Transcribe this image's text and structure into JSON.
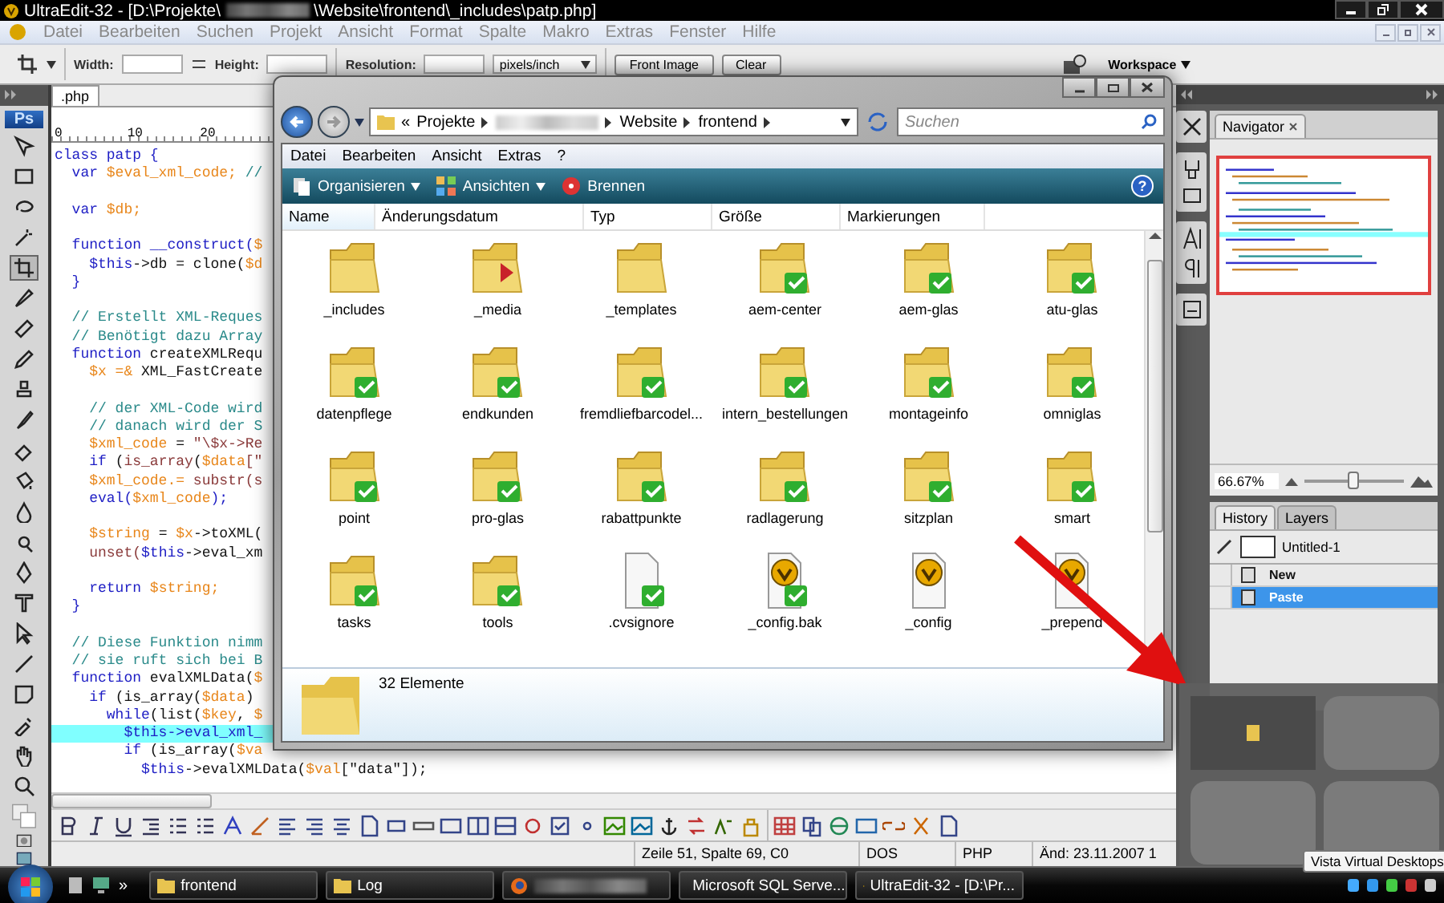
{
  "window": {
    "title_start": "UltraEdit-32 - [D:\\Projekte\\",
    "title_end": "\\Website\\frontend\\_includes\\patp.php]"
  },
  "menu": [
    "Datei",
    "Bearbeiten",
    "Suchen",
    "Projekt",
    "Ansicht",
    "Format",
    "Spalte",
    "Makro",
    "Extras",
    "Fenster",
    "Hilfe"
  ],
  "options_bar": {
    "width_label": "Width:",
    "height_label": "Height:",
    "resolution_label": "Resolution:",
    "unit": "pixels/inch",
    "buttons": [
      "Front Image",
      "Clear"
    ],
    "workspace": "Workspace"
  },
  "toolbox": {
    "logo": "Ps"
  },
  "editor": {
    "tab": ".php",
    "ruler": [
      "0",
      "10",
      "20"
    ],
    "lines": [
      {
        "current": false,
        "segs": [
          {
            "kind": "kw",
            "text": "class patp {"
          }
        ]
      },
      {
        "current": false,
        "segs": [
          {
            "kind": "kw",
            "text": "  var "
          },
          {
            "kind": "var",
            "text": "$eval_xml_code;"
          },
          {
            "kind": "com",
            "text": " //"
          }
        ]
      },
      {
        "current": false
      },
      {
        "current": false,
        "segs": [
          {
            "kind": "kw",
            "text": "  var "
          },
          {
            "kind": "var",
            "text": "$db;"
          }
        ]
      },
      {
        "current": false
      },
      {
        "current": false,
        "segs": [
          {
            "kind": "kw",
            "text": "  function __construct("
          },
          {
            "kind": "var",
            "text": "$"
          }
        ]
      },
      {
        "current": false,
        "segs": [
          {
            "kind": "kw",
            "text": "    $this"
          },
          {
            "kind": "txt",
            "text": "->db = clone("
          },
          {
            "kind": "var",
            "text": "$d"
          }
        ]
      },
      {
        "current": false,
        "segs": [
          {
            "kind": "kw",
            "text": "  }"
          }
        ]
      },
      {
        "current": false
      },
      {
        "current": false,
        "segs": [
          {
            "kind": "com",
            "text": "  // Erstellt XML-Reques"
          }
        ]
      },
      {
        "current": false,
        "segs": [
          {
            "kind": "com",
            "text": "  // Benötigt dazu Array"
          }
        ]
      },
      {
        "current": false,
        "segs": [
          {
            "kind": "kw",
            "text": "  function "
          },
          {
            "kind": "txt",
            "text": "createXMLRequ"
          }
        ]
      },
      {
        "current": false,
        "segs": [
          {
            "kind": "var",
            "text": "    $x =& "
          },
          {
            "kind": "txt",
            "text": "XML_FastCreate"
          }
        ]
      },
      {
        "current": false
      },
      {
        "current": false,
        "segs": [
          {
            "kind": "com",
            "text": "    // der XML-Code wird"
          }
        ]
      },
      {
        "current": false,
        "segs": [
          {
            "kind": "com",
            "text": "    // danach wird der S"
          }
        ]
      },
      {
        "current": false,
        "segs": [
          {
            "kind": "var",
            "text": "    $xml_code"
          },
          {
            "kind": "txt",
            "text": " = "
          },
          {
            "kind": "fn",
            "text": "\"\\$x->Re"
          }
        ]
      },
      {
        "current": false,
        "segs": [
          {
            "kind": "kw",
            "text": "    if "
          },
          {
            "kind": "txt",
            "text": "("
          },
          {
            "kind": "fn",
            "text": "is_array"
          },
          {
            "kind": "txt",
            "text": "("
          },
          {
            "kind": "var",
            "text": "$data"
          },
          {
            "kind": "fn",
            "text": "[\""
          }
        ]
      },
      {
        "current": false,
        "segs": [
          {
            "kind": "var",
            "text": "    $xml_code.= "
          },
          {
            "kind": "fn",
            "text": "substr(s"
          }
        ]
      },
      {
        "current": false,
        "segs": [
          {
            "kind": "kw",
            "text": "    eval("
          },
          {
            "kind": "var",
            "text": "$xml_code"
          },
          {
            "kind": "kw",
            "text": ");"
          }
        ]
      },
      {
        "current": false
      },
      {
        "current": false,
        "segs": [
          {
            "kind": "var",
            "text": "    $string"
          },
          {
            "kind": "txt",
            "text": " = "
          },
          {
            "kind": "var",
            "text": "$x"
          },
          {
            "kind": "txt",
            "text": "->toXML("
          }
        ]
      },
      {
        "current": false,
        "segs": [
          {
            "kind": "fn",
            "text": "    unset("
          },
          {
            "kind": "kw",
            "text": "$this"
          },
          {
            "kind": "txt",
            "text": "->eval_xm"
          }
        ]
      },
      {
        "current": false
      },
      {
        "current": false,
        "segs": [
          {
            "kind": "kw",
            "text": "    return "
          },
          {
            "kind": "var",
            "text": "$string;"
          }
        ]
      },
      {
        "current": false,
        "segs": [
          {
            "kind": "kw",
            "text": "  }"
          }
        ]
      },
      {
        "current": false
      },
      {
        "current": false,
        "segs": [
          {
            "kind": "com",
            "text": "  // Diese Funktion nimm"
          }
        ]
      },
      {
        "current": false,
        "segs": [
          {
            "kind": "com",
            "text": "  // sie ruft sich bei B"
          }
        ]
      },
      {
        "current": false,
        "segs": [
          {
            "kind": "kw",
            "text": "  function "
          },
          {
            "kind": "txt",
            "text": "evalXMLData("
          },
          {
            "kind": "var",
            "text": "$"
          }
        ]
      },
      {
        "current": false,
        "segs": [
          {
            "kind": "kw",
            "text": "    if "
          },
          {
            "kind": "txt",
            "text": "(is_array("
          },
          {
            "kind": "var",
            "text": "$data"
          },
          {
            "kind": "txt",
            "text": ")"
          }
        ]
      },
      {
        "current": false,
        "segs": [
          {
            "kind": "kw",
            "text": "      while"
          },
          {
            "kind": "txt",
            "text": "(list("
          },
          {
            "kind": "var",
            "text": "$key"
          },
          {
            "kind": "txt",
            "text": ", "
          },
          {
            "kind": "var",
            "text": "$"
          }
        ]
      },
      {
        "current": true,
        "segs": [
          {
            "kind": "kw",
            "text": "        $this->eval_xml_"
          }
        ]
      },
      {
        "current": false,
        "segs": [
          {
            "kind": "kw",
            "text": "        if "
          },
          {
            "kind": "txt",
            "text": "(is_array("
          },
          {
            "kind": "var",
            "text": "$va"
          }
        ]
      },
      {
        "current": false,
        "segs": [
          {
            "kind": "kw",
            "text": "          $this"
          },
          {
            "kind": "txt",
            "text": "->evalXMLData("
          },
          {
            "kind": "var",
            "text": "$val"
          },
          {
            "kind": "txt",
            "text": "[\"data\"]);"
          }
        ]
      }
    ],
    "status": [
      "Zeile 51, Spalte 69, C0",
      "DOS",
      "PHP",
      "Änd: 23.11.2007 1"
    ]
  },
  "explorer": {
    "address": {
      "chevron": "«",
      "crumbs": [
        "Projekte",
        "Website",
        "frontend"
      ]
    },
    "search": {
      "placeholder": "Suchen"
    },
    "menu": [
      "Datei",
      "Bearbeiten",
      "Ansicht",
      "Extras",
      "?"
    ],
    "commands": [
      {
        "kind": "organize",
        "label": "Organisieren",
        "dropdown": true
      },
      {
        "kind": "views",
        "label": "Ansichten",
        "dropdown": true
      },
      {
        "kind": "burn",
        "label": "Brennen",
        "dropdown": false
      }
    ],
    "help": "?",
    "columns": [
      {
        "label": "Name",
        "sorted": true
      },
      {
        "label": "Änderungsdatum",
        "sorted": false
      },
      {
        "label": "Typ",
        "sorted": false
      },
      {
        "label": "Größe",
        "sorted": false
      },
      {
        "label": "Markierungen",
        "sorted": false
      }
    ],
    "items": [
      {
        "name": "_includes",
        "kind": "folder",
        "checked": false
      },
      {
        "name": "_media",
        "kind": "media",
        "checked": false
      },
      {
        "name": "_templates",
        "kind": "folder",
        "checked": false
      },
      {
        "name": "aem-center",
        "kind": "folder",
        "checked": true
      },
      {
        "name": "aem-glas",
        "kind": "folder",
        "checked": true
      },
      {
        "name": "atu-glas",
        "kind": "folder",
        "checked": true
      },
      {
        "name": "datenpflege",
        "kind": "folder",
        "checked": true
      },
      {
        "name": "endkunden",
        "kind": "folder",
        "checked": true
      },
      {
        "name": "fremdliefbarcodel...",
        "kind": "folder",
        "checked": true
      },
      {
        "name": "intern_bestellungen",
        "kind": "folder",
        "checked": true
      },
      {
        "name": "montageinfo",
        "kind": "folder",
        "checked": true
      },
      {
        "name": "omniglas",
        "kind": "folder",
        "checked": true
      },
      {
        "name": "point",
        "kind": "folder",
        "checked": true
      },
      {
        "name": "pro-glas",
        "kind": "folder",
        "checked": true
      },
      {
        "name": "rabattpunkte",
        "kind": "folder",
        "checked": true
      },
      {
        "name": "radlagerung",
        "kind": "folder",
        "checked": true
      },
      {
        "name": "sitzplan",
        "kind": "folder",
        "checked": true
      },
      {
        "name": "smart",
        "kind": "folder",
        "checked": true
      },
      {
        "name": "tasks",
        "kind": "folder",
        "checked": true
      },
      {
        "name": "tools",
        "kind": "folder",
        "checked": true
      },
      {
        "name": ".cvsignore",
        "kind": "file",
        "checked": true
      },
      {
        "name": "_config.bak",
        "kind": "ue",
        "checked": true
      },
      {
        "name": "_config",
        "kind": "ue",
        "checked": false
      },
      {
        "name": "_prepend",
        "kind": "ue",
        "checked": false
      }
    ],
    "details": "32 Elemente"
  },
  "navigator": {
    "title": "Navigator",
    "zoom": "66.67%",
    "level": 0.48
  },
  "history": {
    "tabs": [
      {
        "label": "History",
        "selected": true
      },
      {
        "label": "Layers",
        "selected": false
      }
    ],
    "snapshot": "Untitled-1",
    "steps": [
      {
        "label": "New",
        "selected": false
      },
      {
        "label": "Paste",
        "selected": true
      }
    ]
  },
  "taskbar": {
    "quick_more": "»",
    "items": [
      {
        "kind": "folder",
        "label": "frontend"
      },
      {
        "kind": "folder",
        "label": "Log"
      },
      {
        "kind": "browser"
      },
      {
        "kind": "tool",
        "label": "Microsoft SQL Serve..."
      },
      {
        "kind": "editor",
        "label": "UltraEdit-32 - [D:\\Pr..."
      }
    ]
  },
  "tooltip": "Vista Virtual Desktops"
}
